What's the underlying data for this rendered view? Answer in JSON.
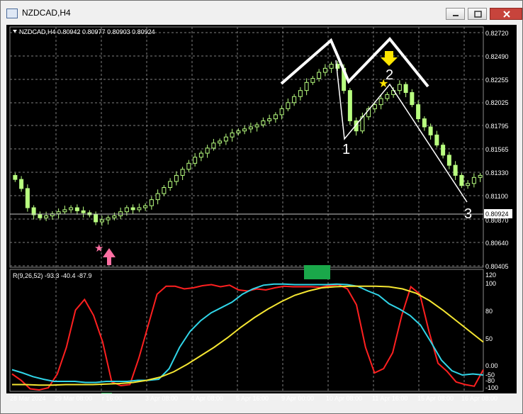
{
  "window": {
    "title": "NZDCAD,H4",
    "buttons": [
      "minimize",
      "maximize",
      "close"
    ]
  },
  "price_panel": {
    "header": "NZDCAD,H4  0.80942 0.80977 0.80903 0.80924",
    "price_labels": [
      "0.82720",
      "0.82490",
      "0.82255",
      "0.82025",
      "0.81795",
      "0.81565",
      "0.81330",
      "0.81100",
      "0.80870",
      "0.80640",
      "0.80405"
    ],
    "current_price": "0.80924",
    "wave_labels": [
      "1",
      "2",
      "3"
    ]
  },
  "indicator_panel": {
    "header": "R(9,26,52) -93.3 -40.4 -87.9",
    "level_labels": [
      "120",
      "100",
      "80",
      "50",
      "0.00",
      "-50",
      "-80",
      "-100"
    ]
  },
  "time_axis": {
    "labels": [
      "28 Mar 2024",
      "29 Mar 08:00",
      "r 16:00",
      "3 Apr 08:00",
      "4 Apr 08:00",
      "5 Apr 16:00",
      "9 Apr 00:00",
      "10 Apr 08:00",
      "11 Apr 16:00",
      "15 Apr 08:00",
      "16 Apr 08:00"
    ]
  },
  "colors": {
    "background": "#000000",
    "candles": "#b9ff80",
    "grid": "#7f7f7f",
    "rsi_fast": "#ff2020",
    "rsi_mid": "#30d5e8",
    "rsi_slow": "#f5e632",
    "marker_green": "#1aa84a",
    "arrow_pink": "#ff6fa3",
    "arrow_yellow": "#ffe600"
  },
  "chart_data": {
    "type": "candlestick",
    "symbol": "NZDCAD",
    "timeframe": "H4",
    "ohlc_last": {
      "open": 0.80942,
      "high": 0.80977,
      "low": 0.80903,
      "close": 0.80924
    },
    "ylim": [
      0.80405,
      0.8272
    ],
    "closes": [
      0.8126,
      0.8117,
      0.8098,
      0.8091,
      0.8088,
      0.809,
      0.8092,
      0.8094,
      0.8096,
      0.8098,
      0.8095,
      0.8093,
      0.8091,
      0.8084,
      0.8086,
      0.8088,
      0.809,
      0.8094,
      0.8098,
      0.8096,
      0.8098,
      0.81,
      0.8106,
      0.8112,
      0.8118,
      0.8124,
      0.813,
      0.8136,
      0.8142,
      0.8148,
      0.8152,
      0.8157,
      0.8162,
      0.8164,
      0.8168,
      0.8172,
      0.8174,
      0.8176,
      0.8178,
      0.818,
      0.8184,
      0.8186,
      0.819,
      0.8196,
      0.8202,
      0.8208,
      0.8214,
      0.8222,
      0.8226,
      0.8232,
      0.8236,
      0.824,
      0.8236,
      0.8214,
      0.8184,
      0.8174,
      0.8188,
      0.8196,
      0.82,
      0.8206,
      0.821,
      0.8214,
      0.822,
      0.8212,
      0.82,
      0.8186,
      0.8178,
      0.817,
      0.816,
      0.815,
      0.814,
      0.813,
      0.812,
      0.8122,
      0.8128,
      0.813
    ],
    "wave_points": [
      {
        "label": "1",
        "price": 0.8174
      },
      {
        "label": "2",
        "price": 0.8222
      },
      {
        "label": "3",
        "price": 0.811
      }
    ],
    "indicator": {
      "name": "R(9,26,52)",
      "ylim": [
        -100,
        120
      ],
      "levels": [
        120,
        100,
        80,
        50,
        0,
        -50,
        -80,
        -100
      ],
      "series": [
        {
          "name": "R9",
          "last": -93.3,
          "values": [
            -70,
            -82,
            -98,
            -100,
            -96,
            -70,
            -20,
            50,
            70,
            40,
            -10,
            -85,
            -92,
            -90,
            -40,
            20,
            80,
            95,
            95,
            90,
            92,
            96,
            98,
            94,
            97,
            88,
            86,
            90,
            88,
            92,
            95,
            94,
            94,
            94,
            93,
            96,
            98,
            90,
            60,
            -20,
            -68,
            -60,
            -30,
            40,
            94,
            80,
            10,
            -50,
            -65,
            -85,
            -90,
            -93,
            -62
          ]
        },
        {
          "name": "R26",
          "last": -40.4,
          "values": [
            -62,
            -68,
            -75,
            -80,
            -84,
            -84,
            -84,
            -86,
            -86,
            -84,
            -84,
            -84,
            -82,
            -82,
            -80,
            -60,
            -20,
            10,
            30,
            45,
            55,
            65,
            80,
            90,
            97,
            99,
            99,
            98,
            98,
            98,
            98,
            99,
            98,
            95,
            86,
            78,
            62,
            52,
            40,
            22,
            -10,
            -44,
            -64,
            -72,
            -70,
            -72
          ]
        },
        {
          "name": "R52",
          "last": -87.9,
          "values": [
            -90,
            -90,
            -91,
            -91,
            -90,
            -90,
            -90,
            -89,
            -88,
            -86,
            -82,
            -76,
            -66,
            -52,
            -36,
            -20,
            -2,
            18,
            36,
            52,
            66,
            78,
            86,
            92,
            94,
            95,
            95,
            95,
            94,
            90,
            82,
            68,
            50,
            30,
            10,
            -10
          ]
        }
      ]
    }
  }
}
